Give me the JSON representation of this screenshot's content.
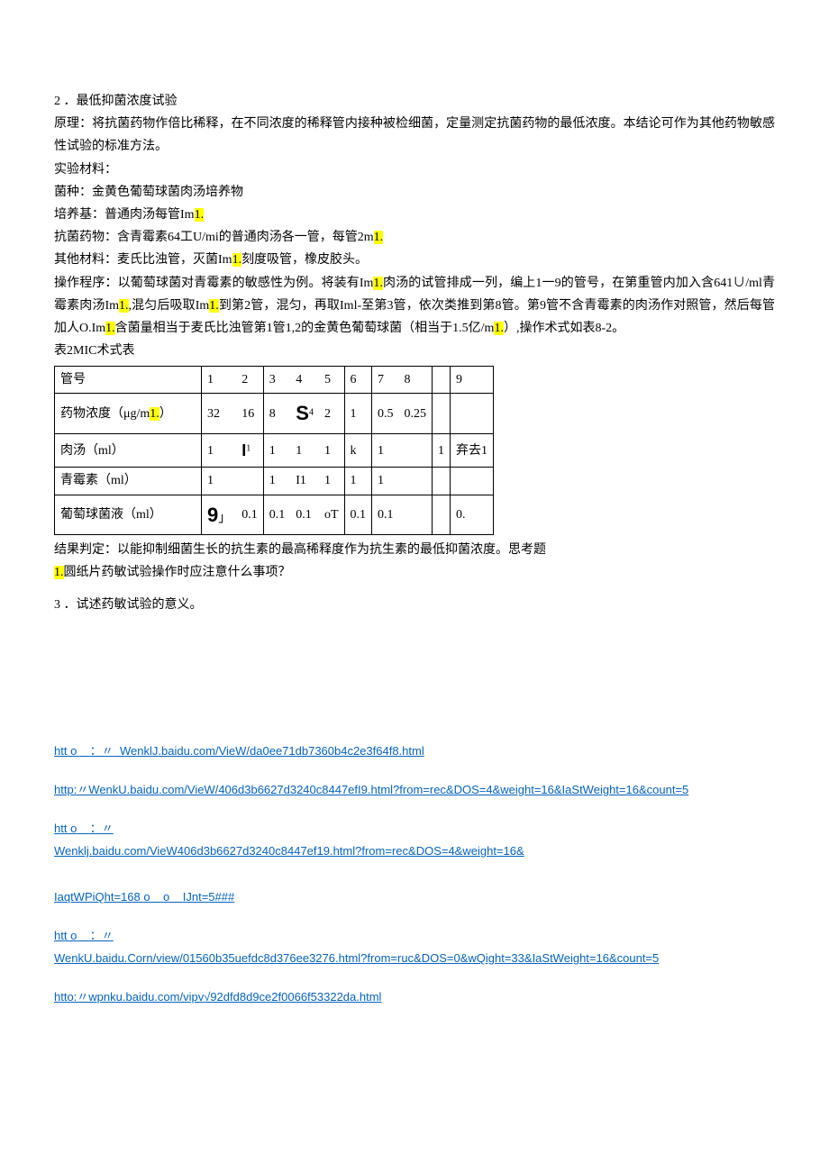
{
  "s2_title": "2 ．最低抑菌浓度试验",
  "p_principle": "原理：将抗菌药物作倍比稀释，在不同浓度的稀释管内接种被检细菌，定量测定抗菌药物的最低浓度。本结论可作为其他药物敏感性试验的标准方法。",
  "p_materials_h": "实验材料：",
  "p_strain": "菌种：金黄色葡萄球菌肉汤培养物",
  "p_medium_a": "培养基：普通肉汤每管Im",
  "p_medium_b": "1.",
  "p_drug_a": "抗菌药物：含青霉素64工U/mi的普通肉汤各一管，每管2m",
  "p_drug_b": "1.",
  "p_other_a": "其他材料：麦氏比浊管，灭菌Im",
  "p_other_b": "1.",
  "p_other_c": "刻度吸管，橡皮胶头。",
  "p_proc_a": "操作程序：以葡萄球菌对青霉素的敏感性为例。将装有Im",
  "p_proc_b": "1.",
  "p_proc_c": "肉汤的试管排成一列，编上1一9的管号，在第重管内加入含641∪/ml青霉素肉汤Im",
  "p_proc_d": "1.",
  "p_proc_e": ",混匀后吸取Im",
  "p_proc_f": "1.",
  "p_proc_g": "到第2管，混匀，再取Iml-至第3管，依次类推到第8管。第9管不含青霉素的肉汤作对照管，然后每管加人O.Im",
  "p_proc_h": "1.",
  "p_proc_i": "含菌量相当于麦氏比浊管第1管1,2的金黄色葡萄球菌（相当于1.5亿/m",
  "p_proc_j": "1.",
  "p_proc_k": "）,操作术式如表8-2。",
  "table_caption": "表2MIC术式表",
  "table": {
    "r1": [
      "管号",
      "1",
      "2",
      "3",
      "4",
      "5",
      "6",
      "7",
      "8",
      "",
      "9"
    ],
    "r2": [
      "药物浓度（μg/m",
      "1.",
      "）",
      "32",
      "16",
      "8",
      "S",
      "4",
      "2",
      "1",
      "0.5",
      "0.25",
      "",
      ""
    ],
    "r3": [
      "肉汤（ml）",
      "1",
      "I",
      "1",
      "1",
      "1",
      "k",
      "1",
      "1",
      "弃去1",
      "1"
    ],
    "r4": [
      "青霉素（ml）",
      "1",
      "",
      "1",
      "I1",
      "1",
      "1",
      "1",
      "",
      ""
    ],
    "r5": [
      "葡萄球菌液（ml）",
      "9",
      "」",
      "0.1",
      "0.1",
      "0.1",
      "oT",
      "0.1",
      "0.1",
      "",
      "0."
    ]
  },
  "p_result": "结果判定：以能抑制细菌生长的抗生素的最高稀释度作为抗生素的最低抑菌浓度。思考题",
  "q1_a": "1.",
  "q1_b": "圆纸片药敏试验操作时应注意什么事项？",
  "q3": "3 ．试述药敏试验的意义。",
  "link1_a": "htt ο",
  "link1_b": "：〃",
  "link1_c": "WenklJ.baidu.com/VieW/da0ee71db7360b4c2e3f64f8.html",
  "link2": "http:〃WenkU.baidu.com/VieW/406d3b6627d3240c8447efI9.html?from=rec&DOS=4&weight=16&IaStWeight=16&count=5",
  "link3_a": "htt ο",
  "link3_b": "：〃",
  "link3_c": "Wenklj.baidu.com/VieW406d3b6627d3240c8447ef19.html?from=rec&DOS=4&weight=16&",
  "link3_d": "IaqtWPiQht=168 ο",
  "link3_e": "ο",
  "link3_f": "IJnt=5###",
  "link4_a": "htt ο",
  "link4_b": "：〃",
  "link4_c": "WenkU.baidu.Corn/view/01560b35uefdc8d376ee3276.html?from=ruc&DOS=0&wQight=33&IaStWeight=16&count=5",
  "link5": "htto:〃wpnku.baidu.com/vipv√92dfd8d9ce2f0066f53322da.html"
}
